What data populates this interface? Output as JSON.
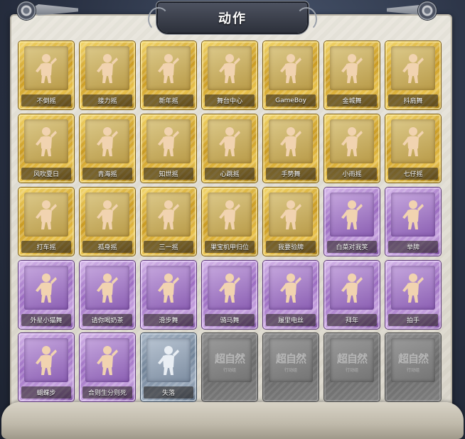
{
  "header": {
    "title": "动作"
  },
  "colors": {
    "gold": "#d9b23a",
    "purple": "#a77bcb",
    "silver": "#8596aa",
    "locked": "#7a7a7a"
  },
  "actions": [
    {
      "label": "不倒摇",
      "tier": "gold"
    },
    {
      "label": "接力摇",
      "tier": "gold"
    },
    {
      "label": "新年摇",
      "tier": "gold"
    },
    {
      "label": "舞台中心",
      "tier": "gold"
    },
    {
      "label": "GameBoy",
      "tier": "gold"
    },
    {
      "label": "金城舞",
      "tier": "gold"
    },
    {
      "label": "抖肩舞",
      "tier": "gold"
    },
    {
      "label": "风吹夏日",
      "tier": "gold"
    },
    {
      "label": "青海摇",
      "tier": "gold"
    },
    {
      "label": "知世摇",
      "tier": "gold"
    },
    {
      "label": "心跳摇",
      "tier": "gold"
    },
    {
      "label": "手势舞",
      "tier": "gold"
    },
    {
      "label": "小雨摇",
      "tier": "gold"
    },
    {
      "label": "七仔摇",
      "tier": "gold"
    },
    {
      "label": "打车摇",
      "tier": "gold"
    },
    {
      "label": "孤身摇",
      "tier": "gold"
    },
    {
      "label": "三一摇",
      "tier": "gold"
    },
    {
      "label": "果宝机甲归位",
      "tier": "gold"
    },
    {
      "label": "我要验牌",
      "tier": "gold"
    },
    {
      "label": "白菜对我笑",
      "tier": "purple"
    },
    {
      "label": "举牌",
      "tier": "purple"
    },
    {
      "label": "外星小猫舞",
      "tier": "purple"
    },
    {
      "label": "请你喝奶茶",
      "tier": "purple"
    },
    {
      "label": "滑步舞",
      "tier": "purple"
    },
    {
      "label": "骑马舞",
      "tier": "purple"
    },
    {
      "label": "履里电丝",
      "tier": "purple"
    },
    {
      "label": "拜年",
      "tier": "purple"
    },
    {
      "label": "拍手",
      "tier": "purple"
    },
    {
      "label": "蝴蝶步",
      "tier": "purple"
    },
    {
      "label": "合则生分则死",
      "tier": "purple"
    },
    {
      "label": "失落",
      "tier": "silver"
    }
  ],
  "locked_slots": [
    {
      "watermark": "超自然",
      "subtext": "行动组"
    },
    {
      "watermark": "超自然",
      "subtext": "行动组"
    },
    {
      "watermark": "超自然",
      "subtext": "行动组"
    },
    {
      "watermark": "超自然",
      "subtext": "行动组"
    }
  ]
}
